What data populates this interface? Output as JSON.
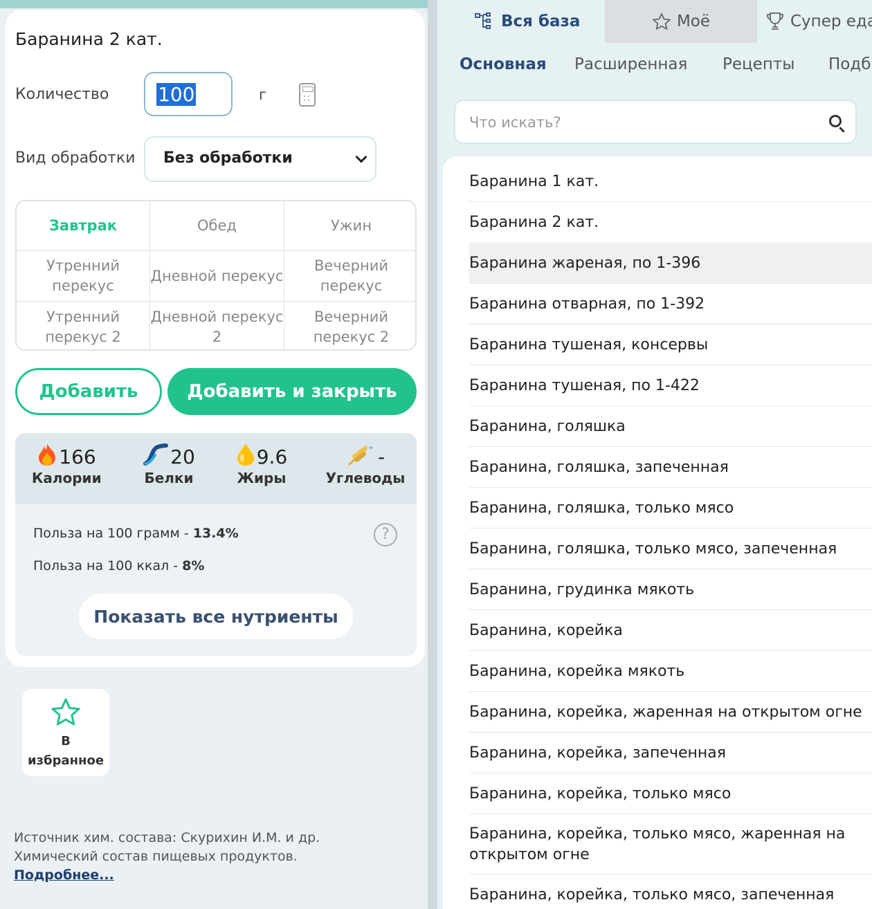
{
  "product": {
    "title": "Баранина 2 кат.",
    "quantity_label": "Количество",
    "quantity_value": "100",
    "unit": "г",
    "processing_label": "Вид обработки",
    "processing_value": "Без обработки"
  },
  "meals": [
    {
      "label": "Завтрак",
      "active": true
    },
    {
      "label": "Обед",
      "active": false
    },
    {
      "label": "Ужин",
      "active": false
    },
    {
      "label": "Утренний перекус",
      "active": false
    },
    {
      "label": "Дневной перекус",
      "active": false
    },
    {
      "label": "Вечерний перекус",
      "active": false
    },
    {
      "label": "Утренний перекус 2",
      "active": false
    },
    {
      "label": "Дневной перекус 2",
      "active": false
    },
    {
      "label": "Вечерний перекус 2",
      "active": false
    }
  ],
  "buttons": {
    "add": "Добавить",
    "add_close": "Добавить и закрыть",
    "show_all": "Показать все нутриенты",
    "favorite": "В избранное"
  },
  "nutrients": {
    "calories": {
      "value": "166",
      "label": "Калории"
    },
    "protein": {
      "value": "20",
      "label": "Белки"
    },
    "fat": {
      "value": "9.6",
      "label": "Жиры"
    },
    "carbs": {
      "value": "-",
      "label": "Углеводы"
    }
  },
  "benefit": {
    "per_100g_label": "Польза на 100 грамм - ",
    "per_100g_value": "13.4%",
    "per_100kcal_label": "Польза на 100 ккал - ",
    "per_100kcal_value": "8%",
    "help": "?"
  },
  "source": {
    "text_1": "Источник хим. состава: Скурихин И.М. и др.",
    "text_2": "Химический состав пищевых продуктов.",
    "link": "Подробнее..."
  },
  "right": {
    "tabs": [
      "Вся база",
      "Моё",
      "Супер еда"
    ],
    "subtabs": [
      "Основная",
      "Расширенная",
      "Рецепты",
      "Подб"
    ],
    "search_placeholder": "Что искать?",
    "items": [
      "Баранина 1 кат.",
      "Баранина 2 кат.",
      "Баранина жареная, по 1-396",
      "Баранина отварная, по 1-392",
      "Баранина тушеная, консервы",
      "Баранина тушеная, по 1-422",
      "Баранина, голяшка",
      "Баранина, голяшка, запеченная",
      "Баранина, голяшка, только мясо",
      "Баранина, голяшка, только мясо, запеченная",
      "Баранина, грудинка мякоть",
      "Баранина, корейка",
      "Баранина, корейка мякоть",
      "Баранина, корейка, жаренная на открытом огне",
      "Баранина, корейка, запеченная",
      "Баранина, корейка, только мясо",
      "Баранина, корейка, только мясо, жаренная на открытом огне",
      "Баранина, корейка, только мясо, запеченная"
    ]
  },
  "colors": {
    "accent_green": "#22c38a",
    "nav_blue": "#2a4b78",
    "selection_blue": "#1e6fd9"
  }
}
